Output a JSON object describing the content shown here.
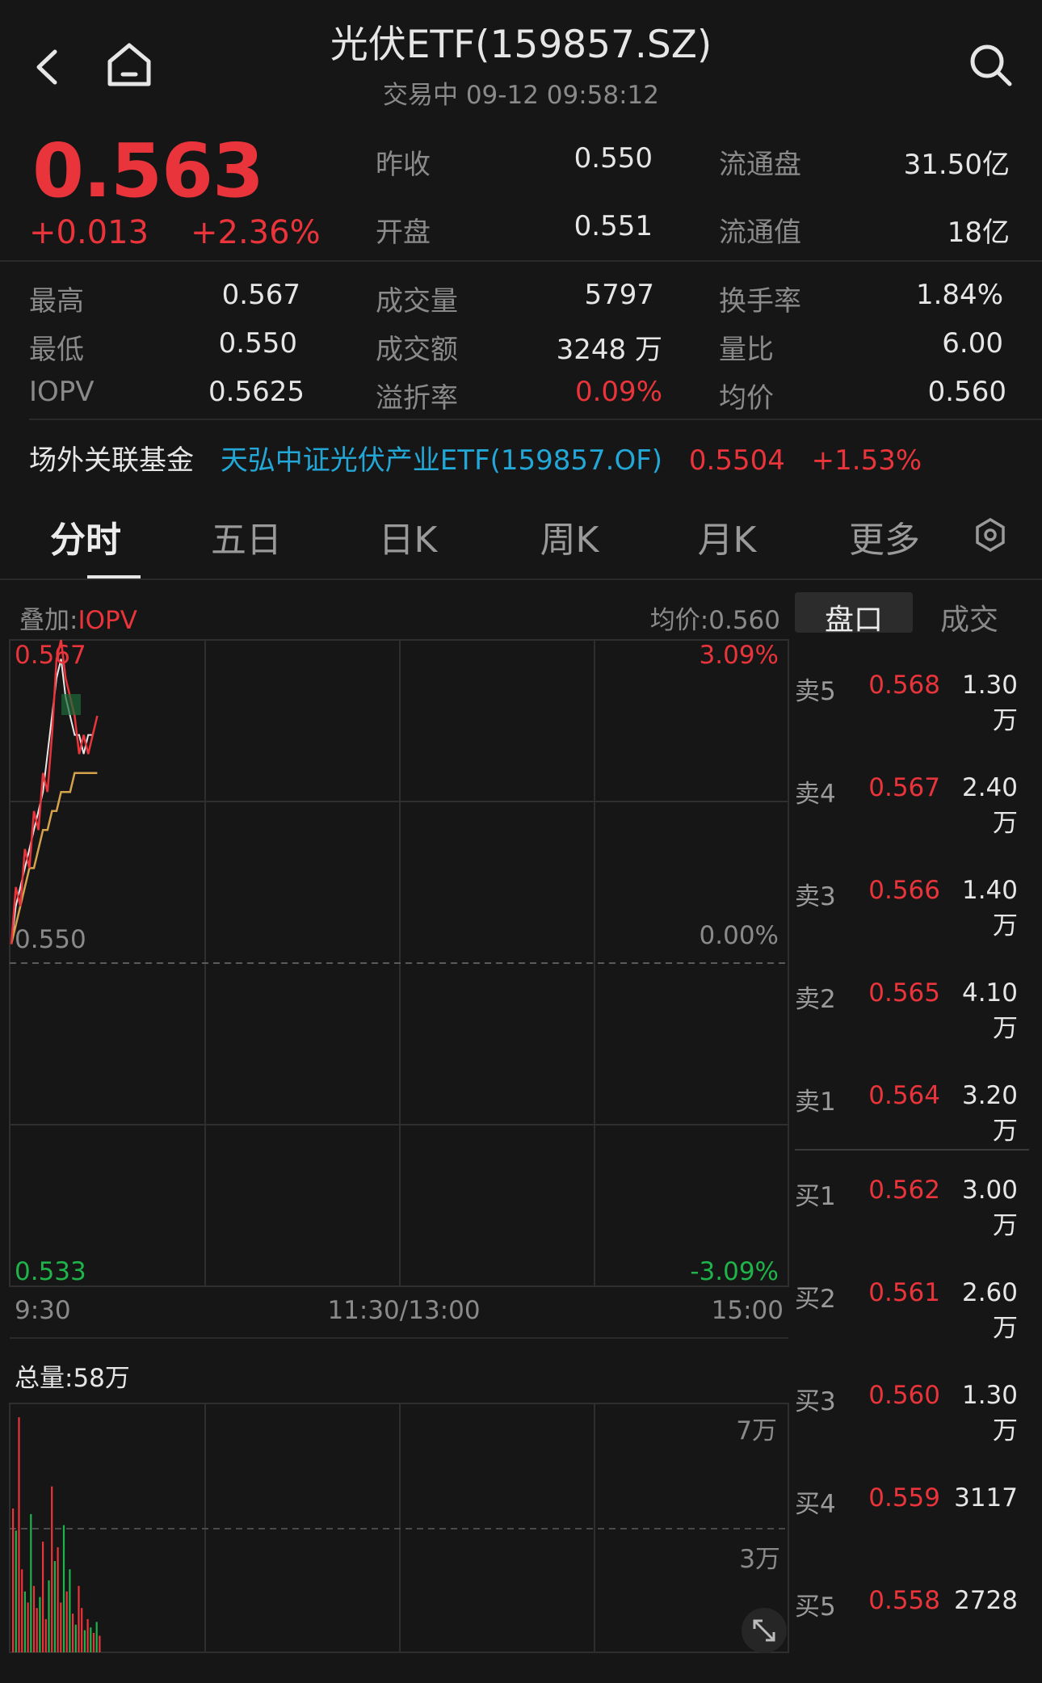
{
  "header": {
    "title": "光伏ETF(159857.SZ)",
    "subtitle": "交易中  09-12 09:58:12"
  },
  "quote": {
    "price": "0.563",
    "change": "+0.013",
    "change_pct": "+2.36%",
    "stats_top": [
      {
        "label": "昨收",
        "value": "0.550"
      },
      {
        "label": "开盘",
        "value": "0.551"
      }
    ],
    "stats_top_right": [
      {
        "label": "流通盘",
        "value": "31.50亿"
      },
      {
        "label": "流通值",
        "value": "18亿"
      }
    ],
    "stats": [
      [
        {
          "label": "最高",
          "value": "0.567"
        },
        {
          "label": "成交量",
          "value": "5797"
        },
        {
          "label": "换手率",
          "value": "1.84%"
        }
      ],
      [
        {
          "label": "最低",
          "value": "0.550"
        },
        {
          "label": "成交额",
          "value": "3248 万"
        },
        {
          "label": "量比",
          "value": "6.00"
        }
      ],
      [
        {
          "label": "IOPV",
          "value": "0.5625"
        },
        {
          "label": "溢折率",
          "value": "0.09%"
        },
        {
          "label": "均价",
          "value": "0.560"
        }
      ]
    ]
  },
  "related_fund": {
    "label": "场外关联基金",
    "name": "天弘中证光伏产业ETF(159857.OF)",
    "price": "0.5504",
    "change": "+1.53%"
  },
  "tabs": [
    "分时",
    "五日",
    "日K",
    "周K",
    "月K",
    "更多"
  ],
  "active_tab": "分时",
  "chart": {
    "overlay_label": "叠加:",
    "overlay_value": "IOPV",
    "avg_label": "均价:0.560",
    "side_tabs": [
      "盘口",
      "成交"
    ],
    "y_top": "0.567",
    "y_mid": "0.550",
    "y_bottom": "0.533",
    "pct_top": "3.09%",
    "pct_mid": "0.00%",
    "pct_bottom": "-3.09%",
    "x_labels": [
      "9:30",
      "11:30/13:00",
      "15:00"
    ],
    "volume_total": "总量:58万",
    "vol_top": "7万",
    "vol_mid": "3万"
  },
  "chart_data": {
    "type": "line",
    "title": "",
    "xlabel": "",
    "ylabel": "",
    "ylim": [
      0.533,
      0.567
    ],
    "x_range": [
      "9:30",
      "15:00"
    ],
    "series": [
      {
        "name": "",
        "values": [
          0.551,
          0.554,
          0.553,
          0.556,
          0.555,
          0.558,
          0.557,
          0.56,
          0.559,
          0.562,
          0.566,
          0.567,
          0.565,
          0.564,
          0.563,
          0.561,
          0.562,
          0.561,
          0.562,
          0.563
        ]
      },
      {
        "name": "IOPV",
        "values": [
          0.551,
          0.553,
          0.554,
          0.555,
          0.556,
          0.557,
          0.558,
          0.559,
          0.561,
          0.563,
          0.565,
          0.566,
          0.564,
          0.563,
          0.562,
          0.562,
          0.561,
          0.562,
          0.562,
          0.563
        ]
      },
      {
        "name": "均价",
        "values": [
          0.551,
          0.552,
          0.553,
          0.554,
          0.555,
          0.555,
          0.556,
          0.557,
          0.557,
          0.558,
          0.558,
          0.559,
          0.559,
          0.559,
          0.56,
          0.56,
          0.56,
          0.56,
          0.56,
          0.56
        ]
      }
    ],
    "volume": {
      "ylim": [
        0,
        90000
      ],
      "up": [
        true,
        false,
        true,
        true,
        false,
        true,
        false,
        true,
        true,
        false,
        true,
        true,
        false,
        true,
        false,
        true,
        true,
        false,
        true,
        false,
        true,
        false,
        true,
        true,
        false,
        true,
        false,
        true,
        false,
        true
      ],
      "values": [
        52000,
        44000,
        85000,
        30000,
        22000,
        18000,
        50000,
        24000,
        16000,
        20000,
        40000,
        12000,
        26000,
        60000,
        33000,
        38000,
        18000,
        46000,
        22000,
        30000,
        14000,
        10000,
        24000,
        16000,
        8000,
        12000,
        9000,
        7000,
        11000,
        6000
      ]
    }
  },
  "order_book": {
    "asks": [
      {
        "label": "卖5",
        "price": "0.568",
        "vol": "1.30万"
      },
      {
        "label": "卖4",
        "price": "0.567",
        "vol": "2.40万"
      },
      {
        "label": "卖3",
        "price": "0.566",
        "vol": "1.40万"
      },
      {
        "label": "卖2",
        "price": "0.565",
        "vol": "4.10万"
      },
      {
        "label": "卖1",
        "price": "0.564",
        "vol": "3.20万"
      }
    ],
    "bids": [
      {
        "label": "买1",
        "price": "0.562",
        "vol": "3.00万"
      },
      {
        "label": "买2",
        "price": "0.561",
        "vol": "2.60万"
      },
      {
        "label": "买3",
        "price": "0.560",
        "vol": "1.30万"
      },
      {
        "label": "买4",
        "price": "0.559",
        "vol": "3117"
      },
      {
        "label": "买5",
        "price": "0.558",
        "vol": "2728"
      }
    ]
  },
  "colors": {
    "up": "#e8343a",
    "down": "#1fb34a",
    "iopv": "#e8e8e8",
    "avg": "#d4a24c",
    "link": "#22a7d6"
  }
}
